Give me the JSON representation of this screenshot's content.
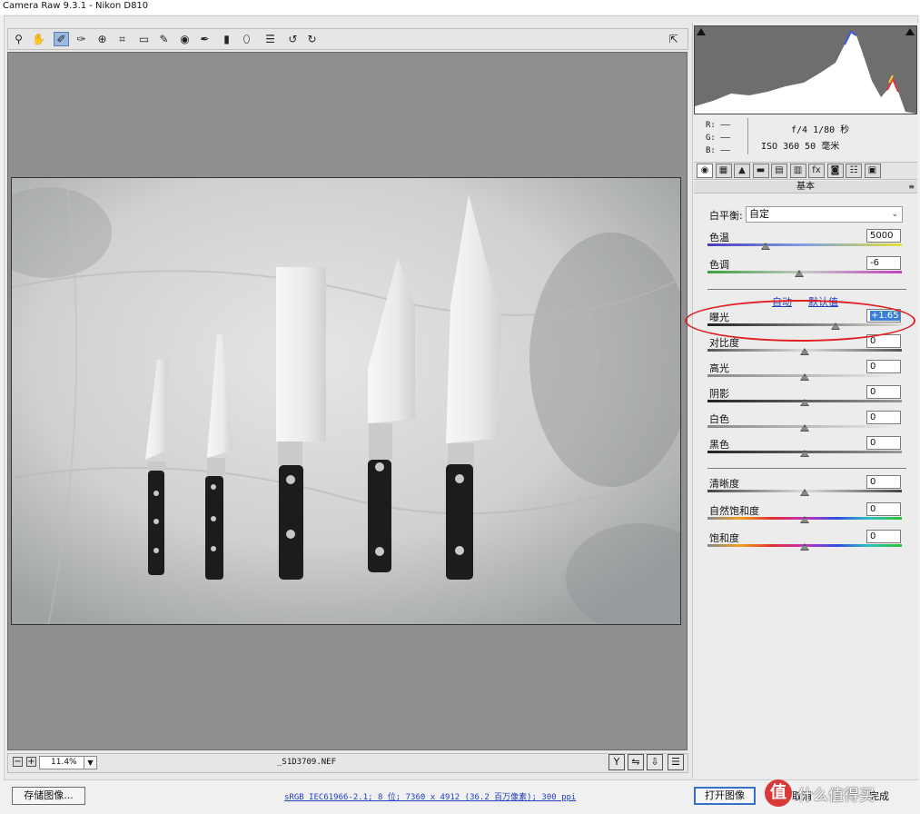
{
  "window": {
    "title": "Camera Raw 9.3.1 -  Nikon D810"
  },
  "toolbar": {
    "tools": [
      {
        "name": "zoom-tool-icon",
        "glyph": "⚲"
      },
      {
        "name": "hand-tool-icon",
        "glyph": "✋"
      },
      {
        "name": "white-balance-tool-icon",
        "glyph": "✐"
      },
      {
        "name": "color-sampler-tool-icon",
        "glyph": "✑"
      },
      {
        "name": "targeted-adjustment-tool-icon",
        "glyph": "⊕"
      },
      {
        "name": "crop-tool-icon",
        "glyph": "⌗"
      },
      {
        "name": "straighten-tool-icon",
        "glyph": "▭"
      },
      {
        "name": "spot-removal-tool-icon",
        "glyph": "✎"
      },
      {
        "name": "red-eye-tool-icon",
        "glyph": "◉"
      },
      {
        "name": "adjustment-brush-icon",
        "glyph": "✒"
      },
      {
        "name": "graduated-filter-icon",
        "glyph": "▮"
      },
      {
        "name": "radial-filter-icon",
        "glyph": "⬯"
      },
      {
        "name": "preferences-icon",
        "glyph": "☰"
      },
      {
        "name": "rotate-ccw-icon",
        "glyph": "↺"
      },
      {
        "name": "rotate-cw-icon",
        "glyph": "↻"
      }
    ]
  },
  "status": {
    "zoom": "11.4%",
    "filename": "_S1D3709.NEF",
    "workflow": "sRGB IEC61966-2.1; 8 位; 7360 x 4912 (36.2 百万像素); 300 ppi"
  },
  "readout": {
    "r": "R:  ——",
    "g": "G:  ——",
    "b": "B:  ——",
    "aperture_shutter": "f/4  1/80 秒",
    "iso_focal": "ISO 360  50 毫米"
  },
  "panel": {
    "title": "基本",
    "menu_icon": "≡",
    "tabs": [
      "◉",
      "▦",
      "▲",
      "▬",
      "▤",
      "▥",
      "fx",
      "◙",
      "☷",
      "▣"
    ],
    "white_balance": {
      "label": "白平衡:",
      "value": "自定"
    },
    "temperature": {
      "label": "色温",
      "value": "5000",
      "position": 0.3
    },
    "tint": {
      "label": "色调",
      "value": "-6",
      "position": 0.47
    },
    "auto_link": "自动",
    "default_link": "默认值",
    "tone": [
      {
        "key": "exposure",
        "label": "曝光",
        "value": "+1.65",
        "position": 0.66
      },
      {
        "key": "contrast",
        "label": "对比度",
        "value": "0",
        "position": 0.5
      },
      {
        "key": "highlights",
        "label": "高光",
        "value": "0",
        "position": 0.5
      },
      {
        "key": "shadows",
        "label": "阴影",
        "value": "0",
        "position": 0.5
      },
      {
        "key": "whites",
        "label": "白色",
        "value": "0",
        "position": 0.5
      },
      {
        "key": "blacks",
        "label": "黑色",
        "value": "0",
        "position": 0.5
      }
    ],
    "presence": [
      {
        "key": "clarity",
        "label": "清晰度",
        "value": "0",
        "position": 0.5
      },
      {
        "key": "vibrance",
        "label": "自然饱和度",
        "value": "0",
        "position": 0.5
      },
      {
        "key": "saturation",
        "label": "饱和度",
        "value": "0",
        "position": 0.5
      }
    ]
  },
  "buttons": {
    "save": "存储图像...",
    "open": "打开图像",
    "cancel": "取消",
    "done": "完成"
  },
  "watermark": {
    "logo": "值",
    "text": "什么值得买"
  }
}
